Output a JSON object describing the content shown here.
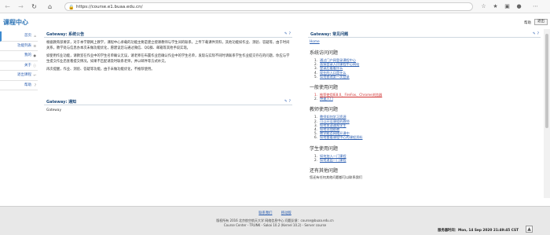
{
  "browser": {
    "url": "https://course.e1.buaa.edu.cn/"
  },
  "header": {
    "title": "课程中心",
    "right_link": "帮助",
    "logout_button": "退出"
  },
  "sidebar": {
    "items": [
      {
        "label": "首页"
      },
      {
        "label": "功能列表"
      },
      {
        "label": "我的"
      },
      {
        "label": "关于"
      },
      {
        "label": "退出课程"
      },
      {
        "label": "帮助"
      }
    ]
  },
  "announcement": {
    "title": "Gateway: 系统公告",
    "paragraphs": [
      "根据教育部要求，对于本学期网上教学，课程中心承载的功能主要是建立授课教师与学生间的联系，上传下载课件资料，其他功能如作业、测验、答疑等，由于时间关系，教学处与信息办本次未做功能优化，愿建议您与通过微信、QQ群、邮箱等其他手段实现。",
      "如使用作业功能，请教室在作业中的学生名单确认无误，请老师在布置作业后确认作业中的学生名单，发现与实际不同时请联系学生作业提交存在的问题，你应与学生提交作业后查看提交情况，如果不匹配请及时联系老师，并以邮件等方式补交。",
      "再次提醒，作业、测验、答疑等功能，由于未做功能优化，不推荐使用。"
    ]
  },
  "notice": {
    "title": "Gateway: 通知",
    "body": "Gateway"
  },
  "faq": {
    "title": "Gateway: 常见问题",
    "home_link": "Home",
    "sections": [
      {
        "heading": "系统访问问题",
        "items": [
          "通过门户网登录课程中心",
          "直接登录入口课程中心网站",
          "登录后看看什么",
          "现在的入口是什么",
          "如何修改第一次登录"
        ]
      },
      {
        "heading": "一般使用问题",
        "items": [
          "推荐使用IE8.0、FireFox、Chrome浏览器",
          "快速入门"
        ],
        "warn_index": 0
      },
      {
        "heading": "教师使用问题",
        "items": [
          "教师如何学习资源",
          "可以开设课程的教师",
          "如何发送通知学生",
          "如何添加助教",
          "教学能否网络开课中",
          "如何查看课程中心的课程资料"
        ]
      },
      {
        "heading": "学生使用问题",
        "items": [
          "如何加入一门课程",
          "如何退出一门课程"
        ]
      },
      {
        "heading": "还有其他问题",
        "note": "您还有任何其他问题都可以联系我们"
      }
    ]
  },
  "footer": {
    "links": [
      "联系我们",
      "移动版"
    ],
    "line1": "版权所有 2016 北京航空航天大学 网络信息中心 问题反馈：course@buaa.edu.cn",
    "line2": "Course Center - TRUNK - Sakai 10.2 (Kernel 10.2) - Server course",
    "time_label": "服务器时间：",
    "time_value": "Mon, 14 Sep 2020 21:49:45 CST"
  }
}
